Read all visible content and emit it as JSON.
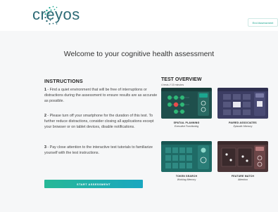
{
  "header": {
    "brand": "creyos",
    "end_button": "End Assessment"
  },
  "main": {
    "title": "Welcome to your cognitive health assessment",
    "instructions": {
      "heading": "INSTRUCTIONS",
      "items": [
        {
          "num": "1",
          "text": " - Find a quiet environment that will be free of interruptions or distractions during the assessment to ensure results are as accurate as possible."
        },
        {
          "num": "2",
          "text": " - Please turn off your smartphone for the duration of this test. To further reduce distractions, consider closing all applications except your browser or on tablet devices, disable notifications."
        },
        {
          "num": "3",
          "text": " - Pay close attention to the interactive test tutorials to familiarize yourself with the test instructions."
        }
      ]
    },
    "start_button": "START ASSESSMENT",
    "overview": {
      "heading": "TEST OVERVIEW",
      "subheading": "4 tests // 15 minutes",
      "tests": [
        {
          "name": "SPATIAL PLANNING",
          "domain": "Executive Functioning",
          "color": "#1f8a7d"
        },
        {
          "name": "PAIRED ASSOCIATES",
          "domain": "Episodic Memory",
          "color": "#3c3d63"
        },
        {
          "name": "TOKEN SEARCH",
          "domain": "Working Memory",
          "color": "#1f7c76"
        },
        {
          "name": "FEATURE MATCH",
          "domain": "Attention",
          "color": "#6b3f40"
        }
      ]
    }
  },
  "colors": {
    "brand": "#2c6a75",
    "accent": "#1ba68f",
    "background": "#f6f7f8"
  }
}
